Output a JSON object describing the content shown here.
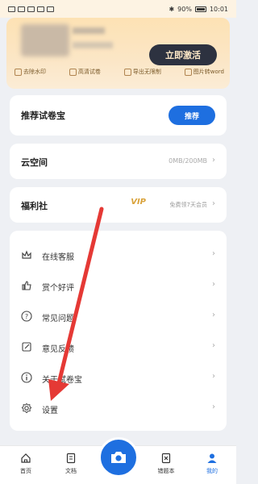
{
  "status_bar": {
    "left_text": "ⁱᴴᴰ",
    "battery": "90%",
    "time": "10:01"
  },
  "vip_card": {
    "activate_label": "立即激活",
    "perks": [
      {
        "icon": "watermark-icon",
        "label": "去除水印"
      },
      {
        "icon": "hd-icon",
        "label": "高清试卷"
      },
      {
        "icon": "export-icon",
        "label": "导出无限制"
      },
      {
        "icon": "word-icon",
        "label": "图片转word"
      }
    ]
  },
  "recommend": {
    "title": "推荐试卷宝",
    "button_label": "推荐"
  },
  "cloud": {
    "title": "云空间",
    "usage": "0MB/200MB"
  },
  "welfare": {
    "title": "福利社",
    "vip_badge": "VIP",
    "vip_desc": "免费领7天会员"
  },
  "menu": {
    "items": [
      {
        "icon": "crown-icon",
        "label": "在线客服"
      },
      {
        "icon": "thumbs-up-icon",
        "label": "赏个好评"
      },
      {
        "icon": "question-icon",
        "label": "常见问题"
      },
      {
        "icon": "edit-icon",
        "label": "意见反馈"
      },
      {
        "icon": "info-icon",
        "label": "关于试卷宝"
      },
      {
        "icon": "settings-icon",
        "label": "设置"
      }
    ]
  },
  "tab_bar": {
    "tabs": [
      {
        "icon": "home-icon",
        "label": "首页"
      },
      {
        "icon": "document-icon",
        "label": "文档"
      },
      {
        "icon": "mistakes-icon",
        "label": "错题本"
      },
      {
        "icon": "profile-icon",
        "label": "我的"
      }
    ],
    "active_index": 3
  },
  "colors": {
    "accent": "#1e6fe0",
    "vip_gold": "#d9a23a",
    "arrow_red": "#e53935",
    "banner_bg": "#fde2b4"
  }
}
